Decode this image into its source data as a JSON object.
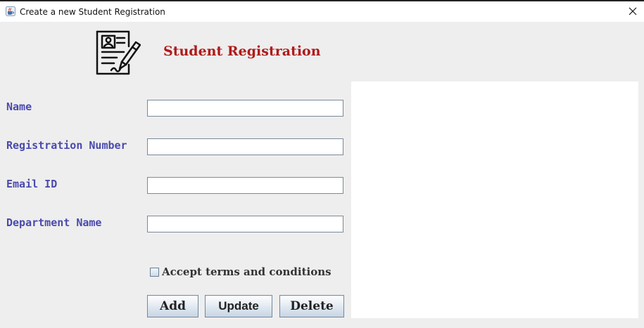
{
  "window": {
    "title": "Create a new Student Registration",
    "app_icon": "java-cup-icon",
    "close_icon": "close-icon"
  },
  "header": {
    "icon": "registration-form-pen-icon",
    "title": "Student Registration",
    "title_color": "#b11a1a"
  },
  "form": {
    "label_color": "#4a4aae",
    "fields": [
      {
        "label": "Name",
        "value": ""
      },
      {
        "label": "Registration Number",
        "value": ""
      },
      {
        "label": "Email ID",
        "value": ""
      },
      {
        "label": "Department Name",
        "value": ""
      }
    ],
    "terms": {
      "label": "Accept terms and conditions",
      "checked": false
    }
  },
  "buttons": {
    "add": "Add",
    "update": "Update",
    "delete": "Delete"
  }
}
